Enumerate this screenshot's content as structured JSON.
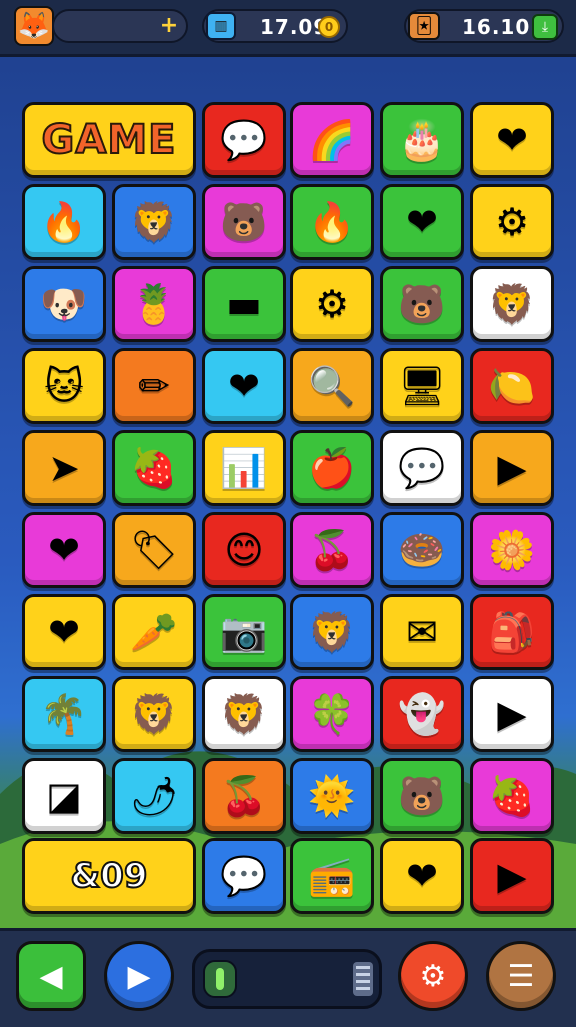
{
  "hud": {
    "avatar_icon": "fox-avatar",
    "add_icon": "+",
    "gems_value": "17.09",
    "gems_icon": "treasure-chest-icon",
    "coins_value": "16.10",
    "coins_icon": "coin-icon",
    "right_icon": "card-pack-icon",
    "claim_icon": "gift-icon"
  },
  "board": {
    "title_tile": "GAME",
    "score_tile": "&09",
    "tiles": [
      {
        "glyph": "💬",
        "bg": "#e8281f"
      },
      {
        "glyph": "🌈",
        "bg": "#e83ad8"
      },
      {
        "glyph": "🎂",
        "bg": "#3bc33b"
      },
      {
        "glyph": "❤",
        "bg": "#ffd21a"
      },
      {
        "glyph": "🔥",
        "bg": "#35c8f2"
      },
      {
        "glyph": "🦁",
        "bg": "#2d7be8"
      },
      {
        "glyph": "🐻",
        "bg": "#e83ad8"
      },
      {
        "glyph": "🔥",
        "bg": "#3bc33b"
      },
      {
        "glyph": "❤",
        "bg": "#3bc33b"
      },
      {
        "glyph": "⚙",
        "bg": "#ffd21a"
      },
      {
        "glyph": "🐶",
        "bg": "#2d7be8"
      },
      {
        "glyph": "🍍",
        "bg": "#e83ad8"
      },
      {
        "glyph": "▬",
        "bg": "#3bc33b"
      },
      {
        "glyph": "⚙",
        "bg": "#ffd21a"
      },
      {
        "glyph": "🐻",
        "bg": "#3bc33b"
      },
      {
        "glyph": "🦁",
        "bg": "#ffffff"
      },
      {
        "glyph": "🐱",
        "bg": "#ffd21a"
      },
      {
        "glyph": "✏",
        "bg": "#f47a1f"
      },
      {
        "glyph": "❤",
        "bg": "#35c8f2"
      },
      {
        "glyph": "🔍",
        "bg": "#f7a81c"
      },
      {
        "glyph": "🖥",
        "bg": "#ffd21a"
      },
      {
        "glyph": "🍋",
        "bg": "#e8281f"
      },
      {
        "glyph": "➤",
        "bg": "#f7a81c"
      },
      {
        "glyph": "🍓",
        "bg": "#3bc33b"
      },
      {
        "glyph": "📊",
        "bg": "#ffd21a"
      },
      {
        "glyph": "🍎",
        "bg": "#3bc33b"
      },
      {
        "glyph": "💬",
        "bg": "#ffffff"
      },
      {
        "glyph": "▶",
        "bg": "#f7a81c"
      },
      {
        "glyph": "❤",
        "bg": "#e83ad8"
      },
      {
        "glyph": "🏷",
        "bg": "#f7a81c"
      },
      {
        "glyph": "😊",
        "bg": "#e8281f"
      },
      {
        "glyph": "🍒",
        "bg": "#e83ad8"
      },
      {
        "glyph": "🍩",
        "bg": "#2d7be8"
      },
      {
        "glyph": "🌼",
        "bg": "#e83ad8"
      },
      {
        "glyph": "❤",
        "bg": "#ffd21a"
      },
      {
        "glyph": "🥕",
        "bg": "#ffd21a"
      },
      {
        "glyph": "📷",
        "bg": "#3bc33b"
      },
      {
        "glyph": "🦁",
        "bg": "#2d7be8"
      },
      {
        "glyph": "✉",
        "bg": "#ffd21a"
      },
      {
        "glyph": "🎒",
        "bg": "#e8281f"
      },
      {
        "glyph": "🌴",
        "bg": "#35c8f2"
      },
      {
        "glyph": "🦁",
        "bg": "#ffd21a"
      },
      {
        "glyph": "🦁",
        "bg": "#ffffff"
      },
      {
        "glyph": "🍀",
        "bg": "#e83ad8"
      },
      {
        "glyph": "👻",
        "bg": "#e8281f"
      },
      {
        "glyph": "▶",
        "bg": "#ffffff"
      },
      {
        "glyph": "◪",
        "bg": "#ffffff"
      },
      {
        "glyph": "🌶",
        "bg": "#35c8f2"
      },
      {
        "glyph": "🍒",
        "bg": "#f47a1f"
      },
      {
        "glyph": "🌞",
        "bg": "#2d7be8"
      },
      {
        "glyph": "🐻",
        "bg": "#3bc33b"
      },
      {
        "glyph": "🍓",
        "bg": "#e83ad8"
      },
      {
        "glyph": "💬",
        "bg": "#2d7be8"
      },
      {
        "glyph": "📻",
        "bg": "#3bc33b"
      },
      {
        "glyph": "❤",
        "bg": "#ffd21a"
      },
      {
        "glyph": "▶",
        "bg": "#e8281f"
      }
    ]
  },
  "controls": {
    "back": "◀",
    "play": "▶",
    "search": "⚙",
    "menu": "☰"
  }
}
